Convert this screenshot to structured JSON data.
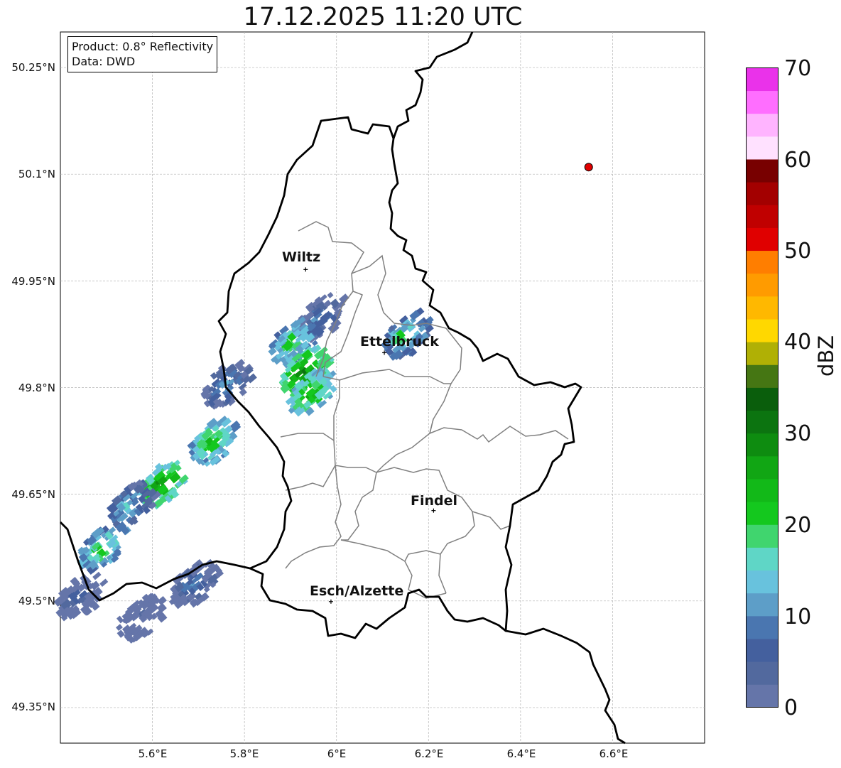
{
  "title": "17.12.2025 11:20 UTC",
  "info_box": {
    "product": "Product: 0.8° Reflectivity",
    "data": "Data: DWD"
  },
  "axes": {
    "lat_ticks": [
      "50.25°N",
      "50.1°N",
      "49.95°N",
      "49.8°N",
      "49.65°N",
      "49.5°N",
      "49.35°N"
    ],
    "lon_ticks": [
      "5.6°E",
      "5.8°E",
      "6°E",
      "6.2°E",
      "6.4°E",
      "6.6°E"
    ],
    "lat_range": [
      49.3,
      50.3
    ],
    "lon_range": [
      5.4,
      6.8
    ],
    "grid": true
  },
  "cities": [
    {
      "name": "Wiltz",
      "lat": 49.966,
      "lon": 5.933
    },
    {
      "name": "Ettelbruck",
      "lat": 49.849,
      "lon": 6.104
    },
    {
      "name": "Findel",
      "lat": 49.627,
      "lon": 6.211
    },
    {
      "name": "Esch/Alzette",
      "lat": 49.499,
      "lon": 5.988
    }
  ],
  "radar_site": {
    "lat": 50.11,
    "lon": 6.548,
    "color": "#e00000"
  },
  "colorbar": {
    "label": "dBZ",
    "min": 0,
    "max": 70,
    "step": 2.5,
    "tick_labels": [
      "70",
      "60",
      "50",
      "40",
      "30",
      "20",
      "10",
      "0"
    ],
    "colors": [
      "#6575a9",
      "#52699e",
      "#44609e",
      "#4a76b0",
      "#5d9ec8",
      "#68c2dd",
      "#5fd6c6",
      "#40d56e",
      "#14c81e",
      "#12b918",
      "#11a614",
      "#0e8c10",
      "#0c7410",
      "#0a5e0c",
      "#457613",
      "#b0b005",
      "#ffd800",
      "#ffb800",
      "#ff9b00",
      "#ff7e00",
      "#e00000",
      "#c00000",
      "#a30000",
      "#780000",
      "#ffe1ff",
      "#ffb4ff",
      "#ff6eff",
      "#ea32ea"
    ]
  },
  "echo_cells": [
    {
      "lat": 49.895,
      "lon": 5.955,
      "dbz": 12
    },
    {
      "lat": 49.86,
      "lon": 5.895,
      "dbz": 22
    },
    {
      "lat": 49.82,
      "lon": 5.92,
      "dbz": 30
    },
    {
      "lat": 49.79,
      "lon": 5.935,
      "dbz": 26
    },
    {
      "lat": 49.87,
      "lon": 6.14,
      "dbz": 20
    },
    {
      "lat": 49.8,
      "lon": 5.75,
      "dbz": 14
    },
    {
      "lat": 49.72,
      "lon": 5.72,
      "dbz": 24
    },
    {
      "lat": 49.66,
      "lon": 5.61,
      "dbz": 28
    },
    {
      "lat": 49.63,
      "lon": 5.54,
      "dbz": 16
    },
    {
      "lat": 49.57,
      "lon": 5.48,
      "dbz": 22
    },
    {
      "lat": 49.52,
      "lon": 5.68,
      "dbz": 12
    },
    {
      "lat": 49.5,
      "lon": 5.43,
      "dbz": 8
    },
    {
      "lat": 49.47,
      "lon": 5.56,
      "dbz": 6
    }
  ]
}
